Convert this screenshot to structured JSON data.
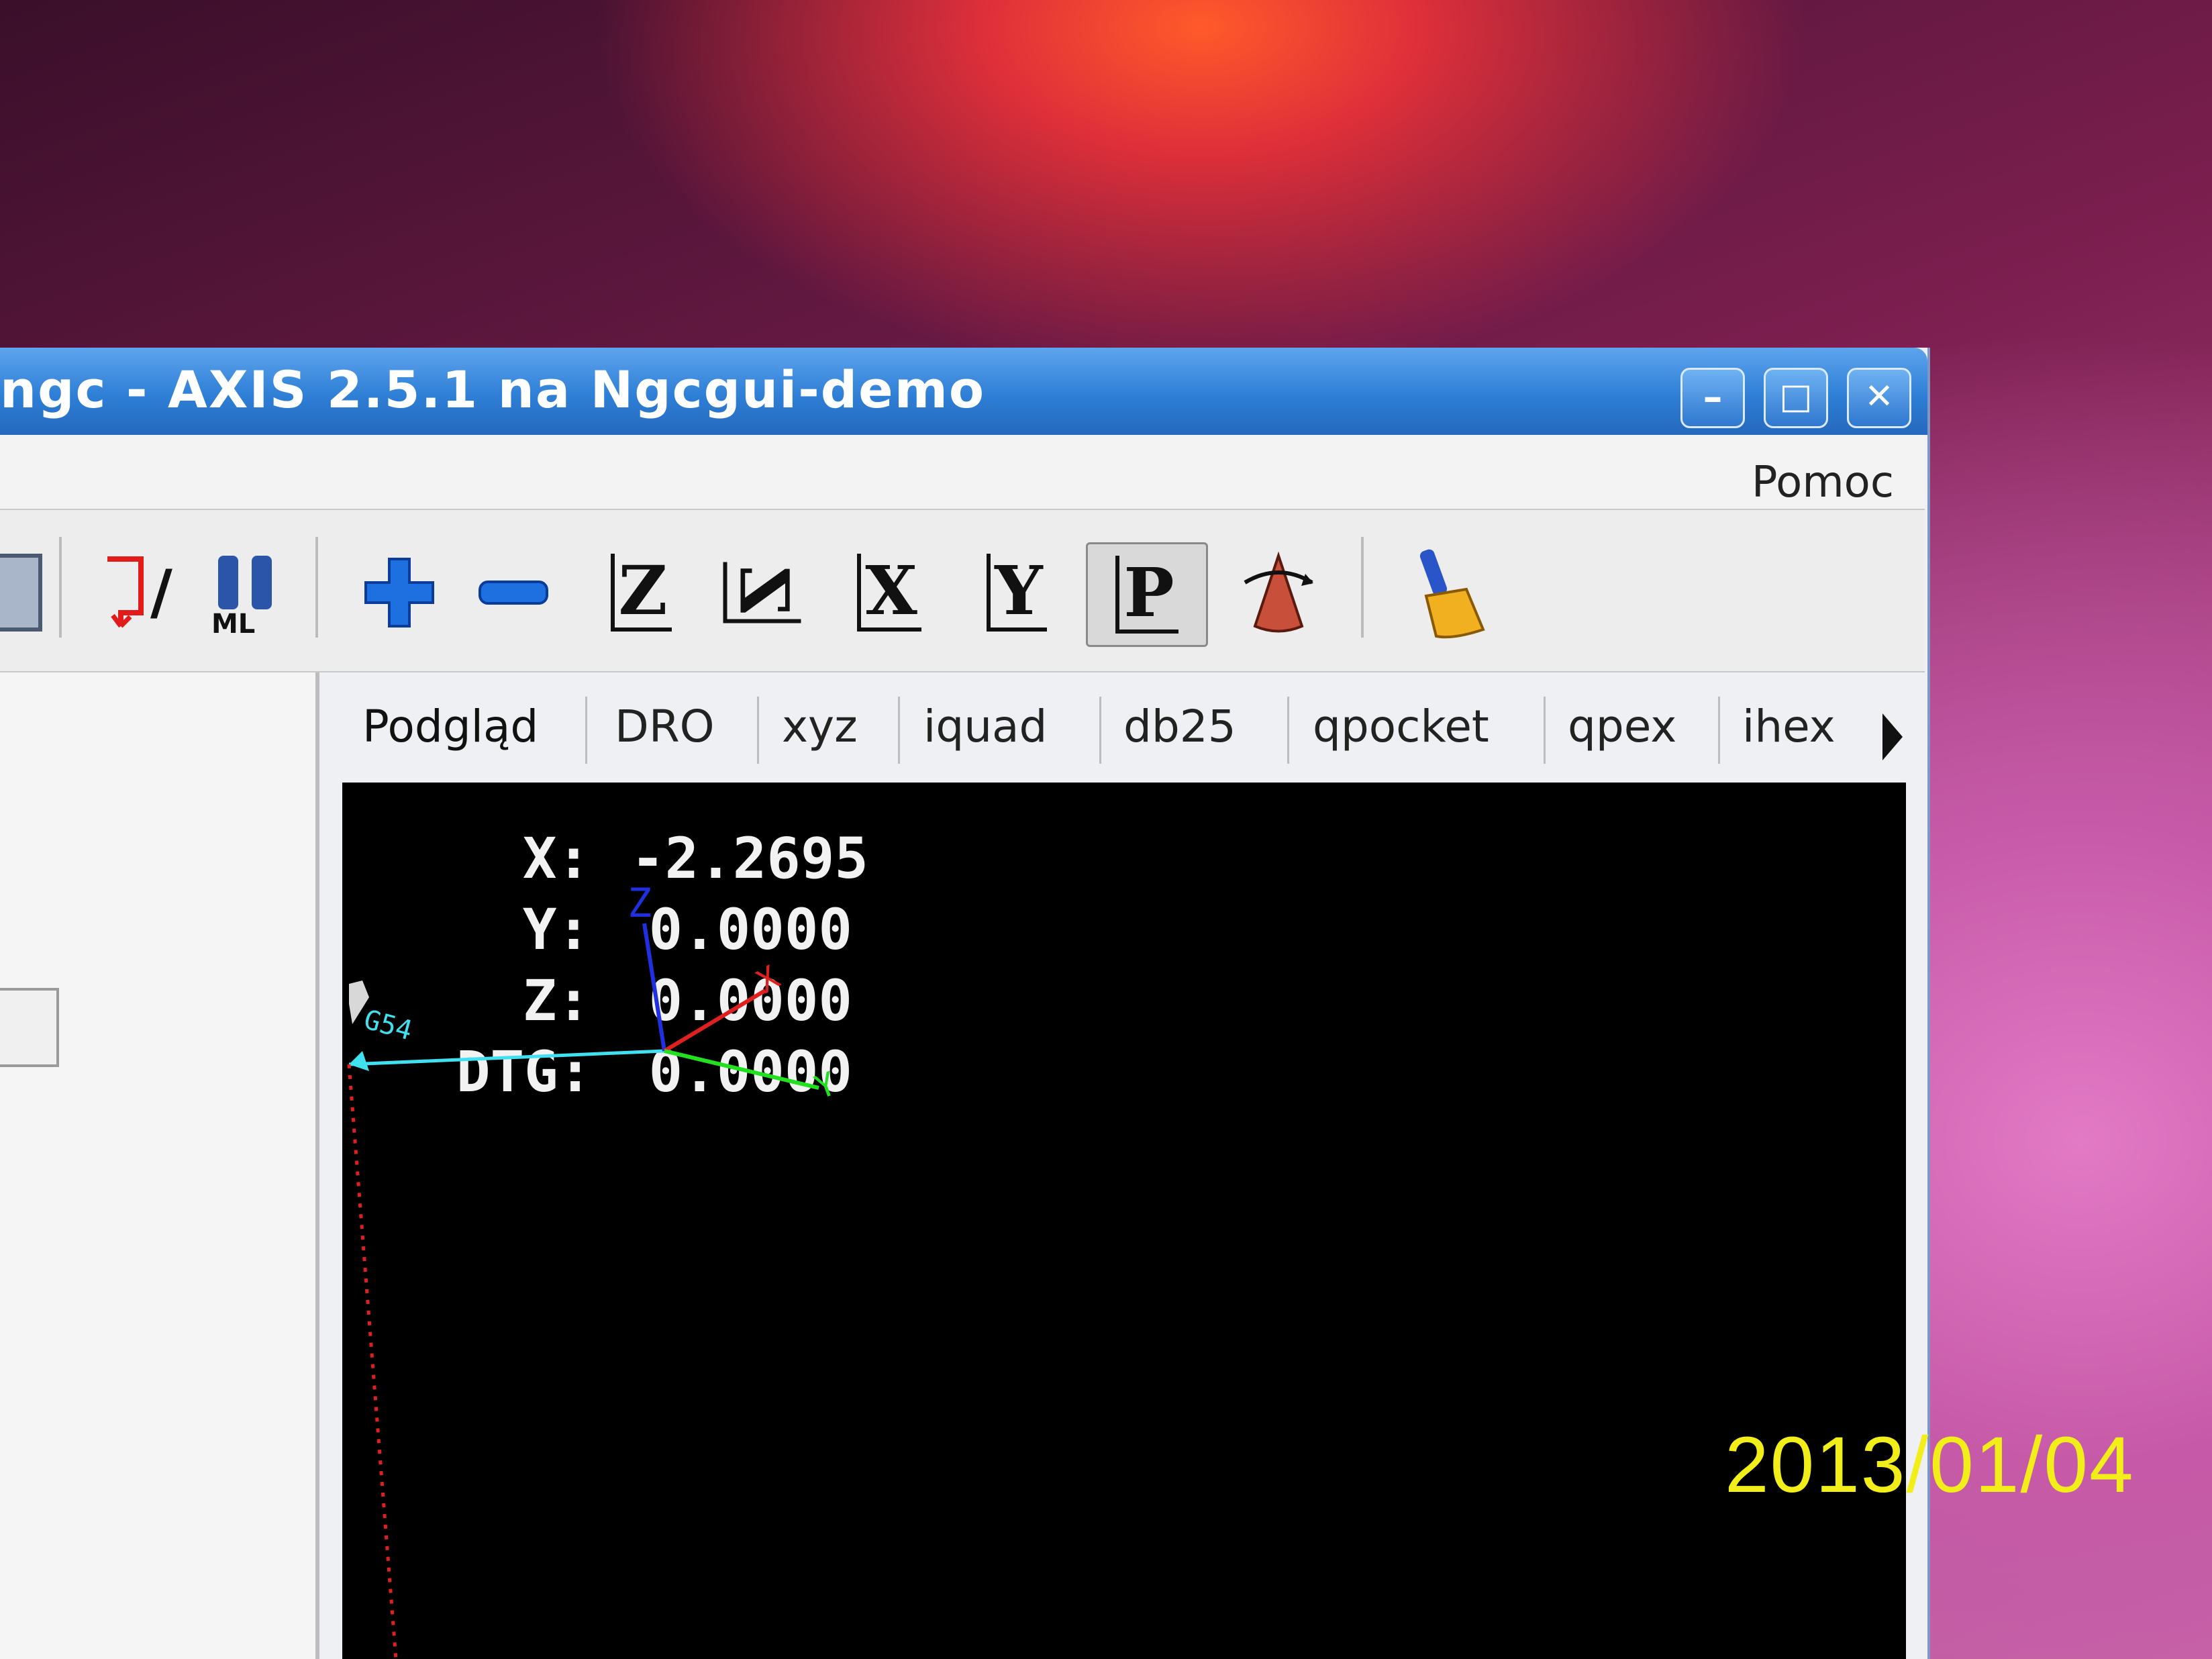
{
  "window": {
    "title": "ngc - AXIS 2.5.1 na Ngcgui-demo",
    "controls": {
      "minimize": "–",
      "maximize": "□",
      "close": "✕"
    }
  },
  "menu": {
    "help": "Pomoc"
  },
  "toolbar": {
    "buttons": [
      {
        "name": "program-icon"
      },
      {
        "name": "toggle-skip-lines-icon",
        "label": "/"
      },
      {
        "name": "optional-stop-icon",
        "label": "ML"
      },
      {
        "name": "zoom-in-icon"
      },
      {
        "name": "zoom-out-icon"
      },
      {
        "name": "view-z-icon",
        "label": "Z"
      },
      {
        "name": "view-rotated-z-icon",
        "label": "Z"
      },
      {
        "name": "view-x-icon",
        "label": "X"
      },
      {
        "name": "view-y-icon",
        "label": "Y"
      },
      {
        "name": "view-perspective-icon",
        "label": "P"
      },
      {
        "name": "rotate-view-icon"
      },
      {
        "name": "clear-backplot-icon"
      }
    ]
  },
  "tabs": [
    "Podgląd",
    "DRO",
    "xyz",
    "iquad",
    "db25",
    "qpocket",
    "qpex",
    "ihex"
  ],
  "dro": [
    {
      "label": "X:",
      "value": "-2.2695"
    },
    {
      "label": "Y:",
      "value": "0.0000"
    },
    {
      "label": "Z:",
      "value": "0.0000"
    },
    {
      "label": "DTG:",
      "value": "0.0000"
    }
  ],
  "preview": {
    "axis_labels": {
      "x": "X",
      "y": "Y",
      "z": "Z"
    },
    "coordinate_system": "G54",
    "colors": {
      "x": "#e02020",
      "y": "#20e020",
      "z": "#2030e0",
      "path": "#40e0f0",
      "rapid": "#e02020"
    }
  },
  "camera_date": "2013/01/04"
}
